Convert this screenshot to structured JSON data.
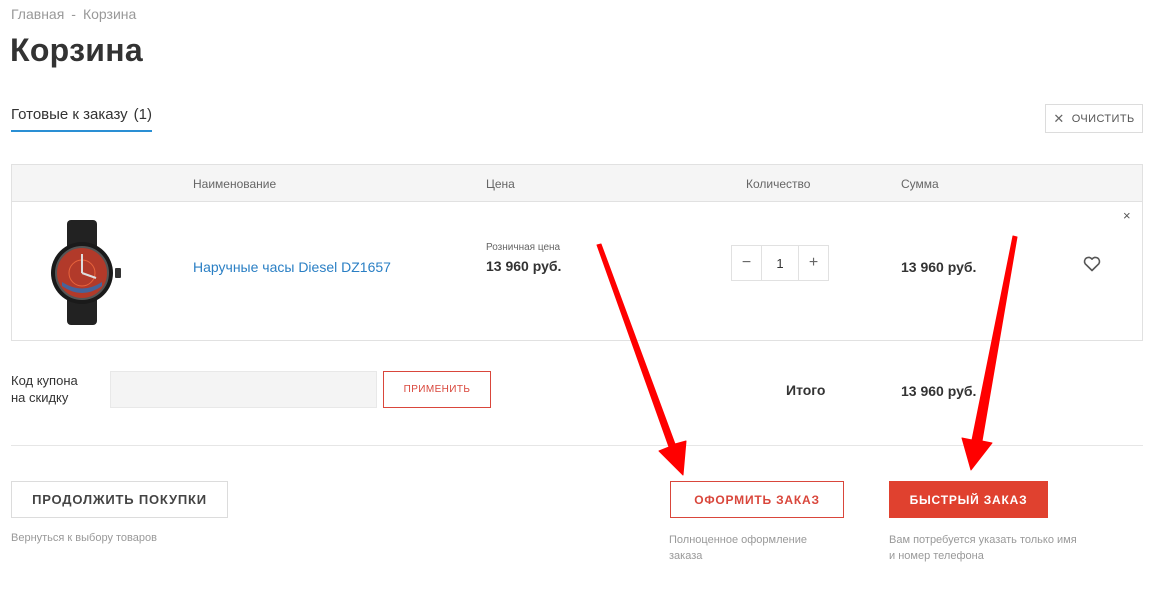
{
  "breadcrumb": {
    "home": "Главная",
    "separator": "-",
    "current": "Корзина"
  },
  "page_title": "Корзина",
  "tab": {
    "label": "Готовые к заказу",
    "count": "(1)"
  },
  "clear_button": {
    "icon": "close-icon",
    "label": "ОЧИСТИТЬ"
  },
  "table": {
    "headers": {
      "name": "Наименование",
      "price": "Цена",
      "quantity": "Количество",
      "sum": "Сумма"
    },
    "items": [
      {
        "image": "watch-image",
        "name": "Наручные часы Diesel DZ1657",
        "price_label": "Розничная цена",
        "price": "13 960 руб.",
        "qty_minus": "−",
        "quantity": "1",
        "qty_plus": "+",
        "sum": "13 960 руб.",
        "remove_icon": "×"
      }
    ]
  },
  "coupon": {
    "label_line1": "Код купона",
    "label_line2": "на скидку",
    "apply_label": "ПРИМЕНИТЬ"
  },
  "total": {
    "label": "Итого",
    "value": "13 960 руб."
  },
  "actions": {
    "continue_label": "ПРОДОЛЖИТЬ ПОКУПКИ",
    "continue_note": "Вернуться к выбору товаров",
    "order_label": "ОФОРМИТЬ ЗАКАЗ",
    "order_note": "Полноценное оформление заказа",
    "quick_label": "БЫСТРЫЙ ЗАКАЗ",
    "quick_note": "Вам потребуется указать только имя и номер телефона"
  },
  "colors": {
    "accent_red": "#e0412f",
    "link_blue": "#2a7fc4",
    "tab_underline": "#2a8fd4",
    "annotation_arrow": "#ff0000"
  }
}
